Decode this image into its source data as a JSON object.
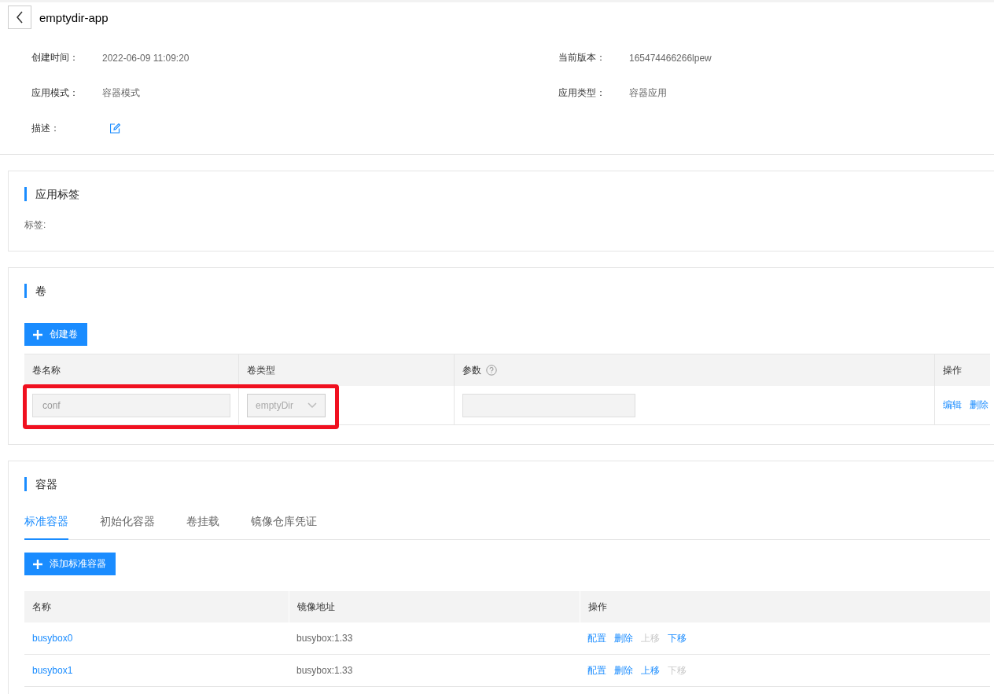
{
  "header": {
    "title": "emptydir-app"
  },
  "info": [
    {
      "kind": "text",
      "label": "创建时间：",
      "value": "2022-06-09 11:09:20"
    },
    {
      "kind": "text",
      "label": "当前版本：",
      "value": "165474466266lpew"
    },
    {
      "kind": "text",
      "label": "应用模式：",
      "value": "容器模式"
    },
    {
      "kind": "text",
      "label": "应用类型：",
      "value": "容器应用"
    },
    {
      "kind": "edit",
      "label": "描述："
    }
  ],
  "labels_section": {
    "title": "应用标签",
    "label": "标签:"
  },
  "volumes": {
    "title": "卷",
    "button": "创建卷",
    "columns": [
      {
        "label": "卷名称",
        "help": false
      },
      {
        "label": "卷类型",
        "help": false
      },
      {
        "label": "参数",
        "help": true
      },
      {
        "label": "操作",
        "help": false
      }
    ],
    "rows": [
      {
        "name": "conf",
        "type": "emptyDir",
        "highlighted": true,
        "actions": [
          "编辑",
          "删除"
        ]
      }
    ]
  },
  "containers": {
    "title": "容器",
    "tabs": [
      {
        "label": "标准容器",
        "selected": true
      },
      {
        "label": "初始化容器",
        "selected": false
      },
      {
        "label": "卷挂载",
        "selected": false
      },
      {
        "label": "镜像仓库凭证",
        "selected": false
      }
    ],
    "button": "添加标准容器",
    "columns": [
      "名称",
      "镜像地址",
      "操作"
    ],
    "rows": [
      {
        "name": "busybox0",
        "image": "busybox:1.33",
        "actions": [
          {
            "label": "配置",
            "disabled": false
          },
          {
            "label": "删除",
            "disabled": false
          },
          {
            "label": "上移",
            "disabled": true
          },
          {
            "label": "下移",
            "disabled": false
          }
        ]
      },
      {
        "name": "busybox1",
        "image": "busybox:1.33",
        "actions": [
          {
            "label": "配置",
            "disabled": false
          },
          {
            "label": "删除",
            "disabled": false
          },
          {
            "label": "上移",
            "disabled": false
          },
          {
            "label": "下移",
            "disabled": true
          }
        ]
      }
    ]
  }
}
